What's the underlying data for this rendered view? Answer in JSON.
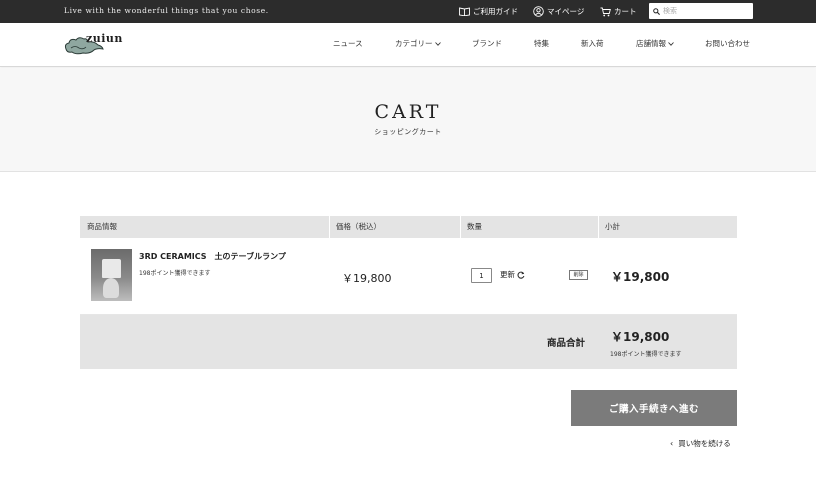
{
  "topbar": {
    "tagline": "Live with the wonderful things that you chose.",
    "links": [
      {
        "label": "ご利用ガイド",
        "icon": "book-icon"
      },
      {
        "label": "マイページ",
        "icon": "user-icon"
      },
      {
        "label": "カート",
        "icon": "cart-icon"
      }
    ],
    "search_placeholder": "検索"
  },
  "header": {
    "logo_text": "zuiun",
    "nav": [
      {
        "label": "ニュース",
        "dropdown": false
      },
      {
        "label": "カテゴリー",
        "dropdown": true
      },
      {
        "label": "ブランド",
        "dropdown": false
      },
      {
        "label": "特集",
        "dropdown": false
      },
      {
        "label": "新入荷",
        "dropdown": false
      },
      {
        "label": "店舗情報",
        "dropdown": true
      },
      {
        "label": "お問い合わせ",
        "dropdown": false
      }
    ]
  },
  "hero": {
    "title": "CART",
    "subtitle": "ショッピングカート"
  },
  "cart": {
    "columns": [
      "商品情報",
      "価格（税込）",
      "数量",
      "小計"
    ],
    "items": [
      {
        "name": "3RD CERAMICS　土のテーブルランプ",
        "points": "198ポイント獲得できます",
        "price": "￥19,800",
        "quantity": "1",
        "update_label": "更新",
        "delete_label": "削除",
        "subtotal": "￥19,800"
      }
    ],
    "total_label": "商品合計",
    "total_amount": "￥19,800",
    "total_points": "198ポイント獲得できます",
    "checkout_label": "ご購入手続きへ進む",
    "continue_label": "買い物を続ける"
  },
  "colors": {
    "topbar_bg": "#2c2c2c",
    "table_header_bg": "#e4e4e4",
    "checkout_bg": "#7b7b7b"
  }
}
